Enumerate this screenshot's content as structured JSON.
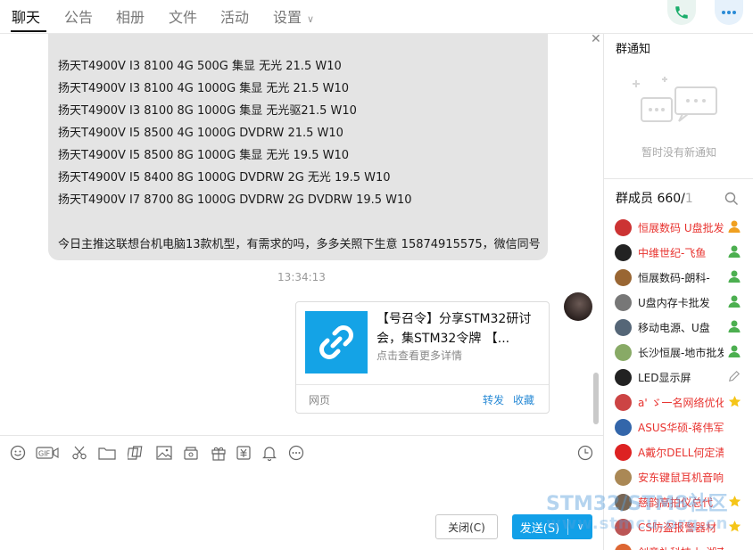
{
  "tabs": [
    {
      "label": "聊天",
      "active": true
    },
    {
      "label": "公告",
      "active": false
    },
    {
      "label": "相册",
      "active": false
    },
    {
      "label": "文件",
      "active": false
    },
    {
      "label": "活动",
      "active": false
    },
    {
      "label": "设置",
      "active": false
    }
  ],
  "header_icons": {
    "call": "phone-icon",
    "more": "more-dots-icon"
  },
  "chat": {
    "message_lines": [
      "扬天T4900V I3 8100 4G 500G 集显 无光 21.5 W10",
      "扬天T4900V I3 8100 4G 1000G 集显 无光 21.5 W10",
      "扬天T4900V I3 8100 8G 1000G 集显 无光驱21.5 W10",
      "扬天T4900V I5 8500 4G 1000G DVDRW 21.5 W10",
      "扬天T4900V I5 8500 8G 1000G 集显 无光 19.5 W10",
      "扬天T4900V I5 8400 8G 1000G DVDRW 2G 无光 19.5 W10",
      "扬天T4900V I7 8700 8G 1000G DVDRW 2G DVDRW 19.5 W10"
    ],
    "message_footer": "今日主推这联想台机电脑13款机型，有需求的吗，多多关照下生意 15874915575，微信同号",
    "timestamp": "13:34:13",
    "card": {
      "title": "【号召令】分享STM32研讨会，集STM32令牌 【...",
      "subtitle": "点击查看更多详情",
      "source": "网页",
      "forward": "转发",
      "favorite": "收藏"
    }
  },
  "toolbar_icons": [
    "emoji-icon",
    "gif-icon",
    "scissors-icon",
    "folder-icon",
    "dice-icon",
    "image-icon",
    "red-packet-icon",
    "gift-icon",
    "payment-icon",
    "bell-icon",
    "more-icon"
  ],
  "input": {
    "close_label": "关闭(C)",
    "send_label": "发送(S)"
  },
  "notice": {
    "title": "群通知",
    "empty_text": "暂时没有新通知"
  },
  "members": {
    "title": "群成员 660/",
    "total": "1",
    "list": [
      {
        "name": "恒展数码 U盘批发",
        "color": "#e8332f",
        "avatar": "#c33",
        "badge": "owner"
      },
      {
        "name": "中维世纪-飞鱼",
        "color": "#e8332f",
        "avatar": "#222",
        "badge": "admin"
      },
      {
        "name": "恒展数码-朗科-",
        "color": "#222222",
        "avatar": "#963",
        "badge": "admin"
      },
      {
        "name": "U盘内存卡批发",
        "color": "#222222",
        "avatar": "#777",
        "badge": "admin"
      },
      {
        "name": "移动电源、U盘",
        "color": "#222222",
        "avatar": "#567",
        "badge": "admin"
      },
      {
        "name": "长沙恒展-地市批发",
        "color": "#222222",
        "avatar": "#8a6",
        "badge": "admin"
      },
      {
        "name": "LED显示屏",
        "color": "#222222",
        "avatar": "#222",
        "badge": "edit"
      },
      {
        "name": "a' ゞ一名网络优化",
        "color": "#e8332f",
        "avatar": "#c44",
        "badge": "star"
      },
      {
        "name": "ASUS华硕-蒋伟军-湖",
        "color": "#e8332f",
        "avatar": "#36a",
        "badge": "none"
      },
      {
        "name": "A戴尔DELL何定清",
        "color": "#e8332f",
        "avatar": "#d22",
        "badge": "none"
      },
      {
        "name": "安东键鼠耳机音响-小",
        "color": "#e8332f",
        "avatar": "#a85",
        "badge": "none"
      },
      {
        "name": "慈韵高拍仪总代",
        "color": "#e8332f",
        "avatar": "#765",
        "badge": "star"
      },
      {
        "name": "CS防盗报警器材",
        "color": "#e8332f",
        "avatar": "#b55",
        "badge": "star"
      },
      {
        "name": "创意礼科技小-湖南",
        "color": "#e8332f",
        "avatar": "#d63",
        "badge": "none"
      }
    ]
  },
  "watermark": {
    "line1": "STM32/STM8社区",
    "line2": "www.stmcu.org.cn"
  }
}
